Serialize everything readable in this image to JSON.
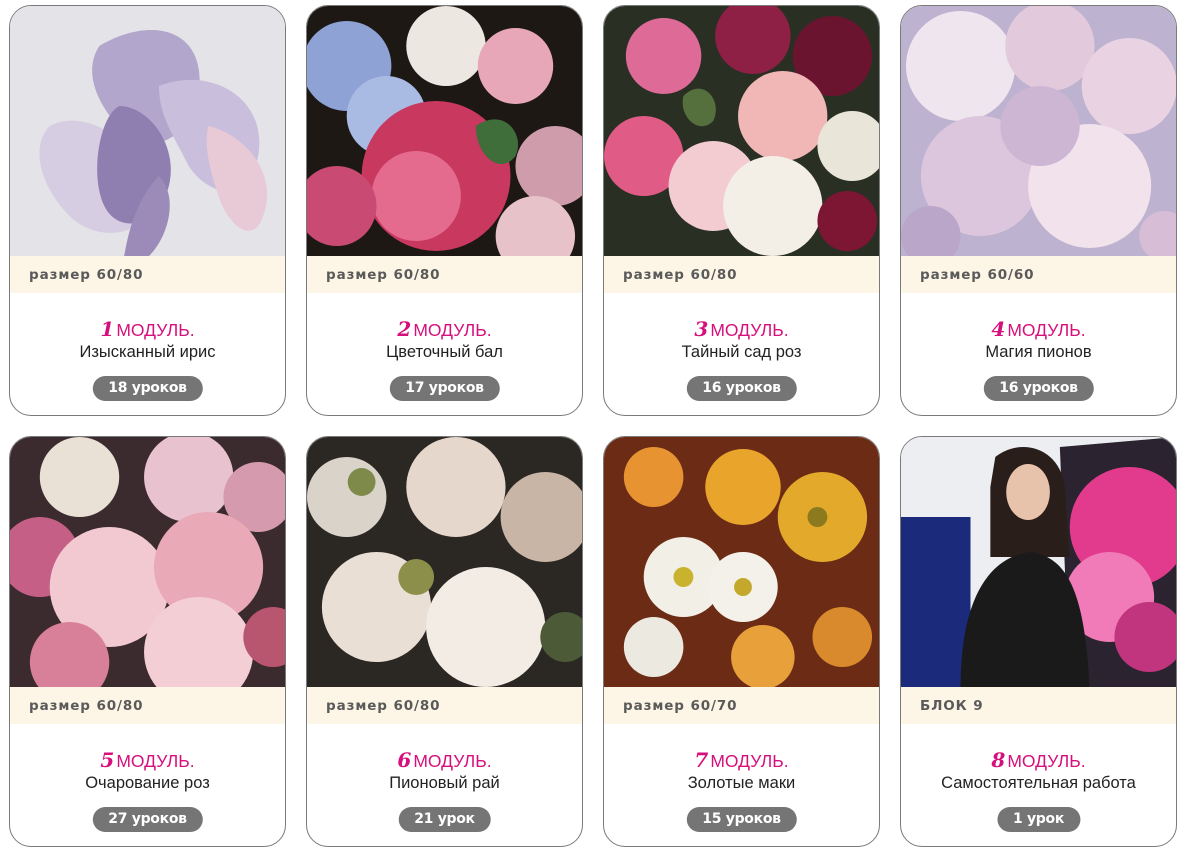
{
  "modules": [
    {
      "size_label": "размер 60/80",
      "number": "1",
      "module_word": "МОДУЛЬ.",
      "title": "Изысканный ирис",
      "lessons": "18 уроков",
      "image": "iris-painting"
    },
    {
      "size_label": "размер 60/80",
      "number": "2",
      "module_word": "МОДУЛЬ.",
      "title": "Цветочный бал",
      "lessons": "17 уроков",
      "image": "flower-ball-painting"
    },
    {
      "size_label": "размер 60/80",
      "number": "3",
      "module_word": "МОДУЛЬ.",
      "title": "Тайный сад роз",
      "lessons": "16 уроков",
      "image": "secret-rose-garden-painting"
    },
    {
      "size_label": "размер 60/60",
      "number": "4",
      "module_word": "МОДУЛЬ.",
      "title": "Магия пионов",
      "lessons": "16 уроков",
      "image": "peony-magic-painting"
    },
    {
      "size_label": "размер 60/80",
      "number": "5",
      "module_word": "МОДУЛЬ.",
      "title": "Очарование роз",
      "lessons": "27 уроков",
      "image": "rose-charm-painting"
    },
    {
      "size_label": "размер 60/80",
      "number": "6",
      "module_word": "МОДУЛЬ.",
      "title": "Пионовый рай",
      "lessons": "21 урок",
      "image": "peony-paradise-painting"
    },
    {
      "size_label": "размер 60/70",
      "number": "7",
      "module_word": "МОДУЛЬ.",
      "title": "Золотые маки",
      "lessons": "15 уроков",
      "image": "golden-poppies-painting"
    },
    {
      "size_label": "БЛОК 9",
      "number": "8",
      "module_word": "МОДУЛЬ.",
      "title": "Самостоятельная работа",
      "lessons": "1 урок",
      "image": "artist-with-painting-photo"
    }
  ],
  "colors": {
    "module_accent": "#d60f7c",
    "size_strip": "#fdf6e6",
    "lessons_pill": "#757575"
  }
}
